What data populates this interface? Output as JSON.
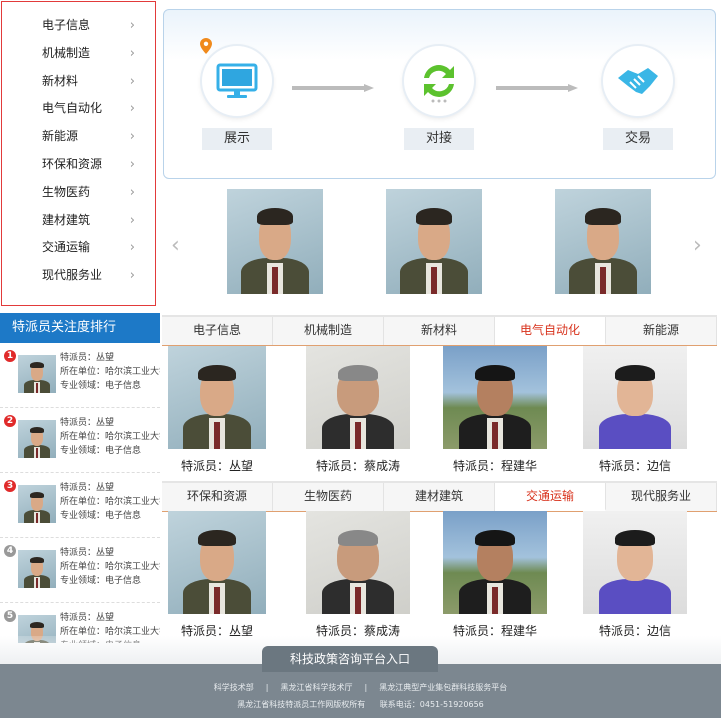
{
  "menu": [
    {
      "label": "电子信息"
    },
    {
      "label": "机械制造"
    },
    {
      "label": "新材料"
    },
    {
      "label": "电气自动化"
    },
    {
      "label": "新能源"
    },
    {
      "label": "环保和资源"
    },
    {
      "label": "生物医药"
    },
    {
      "label": "建材建筑"
    },
    {
      "label": "交通运输"
    },
    {
      "label": "现代服务业"
    }
  ],
  "chevron": "›",
  "flow": {
    "step1": "展示",
    "step2": "对接",
    "step3": "交易"
  },
  "colors": {
    "accent": "#1d79c7",
    "active_tab": "#d8331d",
    "menu_border": "#e23a3a"
  },
  "ranking": {
    "title": "特派员关注度排行",
    "items": [
      {
        "num": "1",
        "name": "特派员：丛望",
        "unit": "所在单位：哈尔滨工业大学",
        "field": "专业领域：电子信息",
        "color": "#e02a2a"
      },
      {
        "num": "2",
        "name": "特派员：丛望",
        "unit": "所在单位：哈尔滨工业大学",
        "field": "专业领域：电子信息",
        "color": "#e02a2a"
      },
      {
        "num": "3",
        "name": "特派员：丛望",
        "unit": "所在单位：哈尔滨工业大学",
        "field": "专业领域：电子信息",
        "color": "#e02a2a"
      },
      {
        "num": "4",
        "name": "特派员：丛望",
        "unit": "所在单位：哈尔滨工业大学",
        "field": "专业领域：电子信息",
        "color": "#999999"
      },
      {
        "num": "5",
        "name": "特派员：丛望",
        "unit": "所在单位：哈尔滨工业大学",
        "field": "专业领域：电子信息",
        "color": "#999999"
      }
    ]
  },
  "tabs1": [
    "电子信息",
    "机械制造",
    "新材料",
    "电气自动化",
    "新能源"
  ],
  "tabs2": [
    "环保和资源",
    "生物医药",
    "建材建筑",
    "交通运输",
    "现代服务业"
  ],
  "people1": [
    "特派员：丛望",
    "特派员：蔡成涛",
    "特派员：程建华",
    "特派员：边信"
  ],
  "people2": [
    "特派员：丛望",
    "特派员：蔡成涛",
    "特派员：程建华",
    "特派员：边信"
  ],
  "footer": {
    "entry": "科技政策咨询平台入口",
    "links": [
      "科学技术部",
      "|",
      "黑龙江省科学技术厅",
      "|",
      "黑龙江典型产业集包群科技服务平台"
    ],
    "copyright": "黑龙江省科技特派员工作网版权所有",
    "phone": "联系电话：0451-51920656"
  }
}
